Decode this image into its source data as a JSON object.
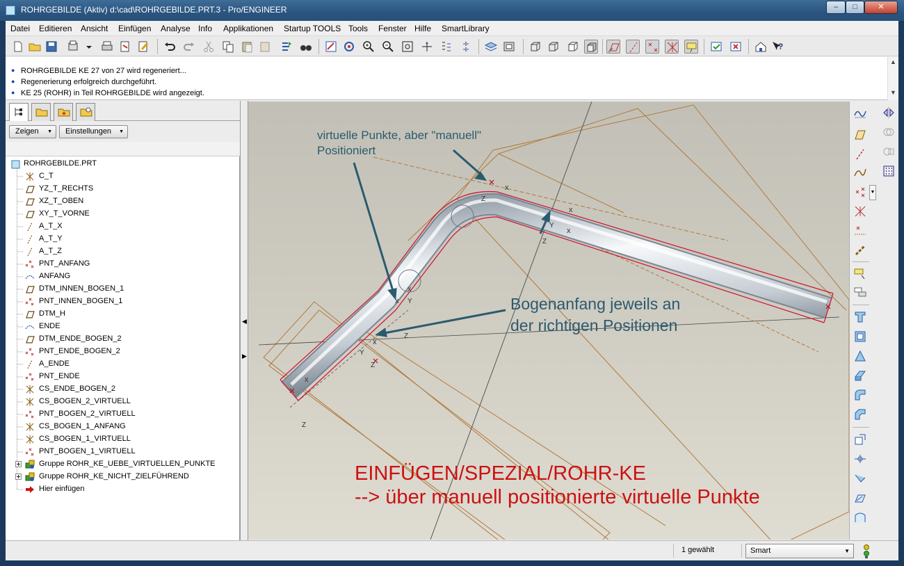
{
  "window": {
    "title": "ROHRGEBILDE (Aktiv) d:\\cad\\ROHRGEBILDE.PRT.3 - Pro/ENGINEER",
    "minimize": "–",
    "maximize": "□",
    "close": "✕"
  },
  "menu": [
    "Datei",
    "Editieren",
    "Ansicht",
    "Einfügen",
    "Analyse",
    "Info",
    "Applikationen",
    "Startup TOOLS",
    "Tools",
    "Fenster",
    "Hilfe",
    "SmartLibrary"
  ],
  "messages": [
    "ROHRGEBILDE KE 27 von 27 wird regeneriert...",
    "Regenerierung erfolgreich durchgeführt.",
    "KE 25 (ROHR) in Teil ROHRGEBILDE wird angezeigt."
  ],
  "model_tree": {
    "show_button": "Zeigen",
    "settings_button": "Einstellungen",
    "root": "ROHRGEBILDE.PRT",
    "items": [
      {
        "label": "C_T",
        "icon": "csys-icon"
      },
      {
        "label": "YZ_T_RECHTS",
        "icon": "datum-plane-icon"
      },
      {
        "label": "XZ_T_OBEN",
        "icon": "datum-plane-icon"
      },
      {
        "label": "XY_T_VORNE",
        "icon": "datum-plane-icon"
      },
      {
        "label": "A_T_X",
        "icon": "datum-axis-icon"
      },
      {
        "label": "A_T_Y",
        "icon": "datum-axis-icon"
      },
      {
        "label": "A_T_Z",
        "icon": "datum-axis-icon"
      },
      {
        "label": "PNT_ANFANG",
        "icon": "datum-point-icon"
      },
      {
        "label": "ANFANG",
        "icon": "curve-icon"
      },
      {
        "label": "DTM_INNEN_BOGEN_1",
        "icon": "datum-plane-icon"
      },
      {
        "label": "PNT_INNEN_BOGEN_1",
        "icon": "datum-point-icon"
      },
      {
        "label": "DTM_H",
        "icon": "datum-plane-icon"
      },
      {
        "label": "ENDE",
        "icon": "curve-icon"
      },
      {
        "label": "DTM_ENDE_BOGEN_2",
        "icon": "datum-plane-icon"
      },
      {
        "label": "PNT_ENDE_BOGEN_2",
        "icon": "datum-point-icon"
      },
      {
        "label": "A_ENDE",
        "icon": "datum-axis-icon"
      },
      {
        "label": "PNT_ENDE",
        "icon": "datum-point-icon"
      },
      {
        "label": "CS_ENDE_BOGEN_2",
        "icon": "csys-icon"
      },
      {
        "label": "CS_BOGEN_2_VIRTUELL",
        "icon": "csys-icon"
      },
      {
        "label": "PNT_BOGEN_2_VIRTUELL",
        "icon": "datum-point-icon"
      },
      {
        "label": "CS_BOGEN_1_ANFANG",
        "icon": "csys-icon"
      },
      {
        "label": "CS_BOGEN_1_VIRTUELL",
        "icon": "csys-icon"
      },
      {
        "label": "PNT_BOGEN_1_VIRTUELL",
        "icon": "datum-point-icon"
      },
      {
        "label": "Gruppe ROHR_KE_UEBE_VIRTUELLEN_PUNKTE",
        "icon": "group-icon"
      },
      {
        "label": "Gruppe ROHR_KE_NICHT_ZIELFÜHREND",
        "icon": "group-icon"
      },
      {
        "label": "Hier einfügen",
        "icon": "insert-arrow-icon"
      }
    ]
  },
  "annotations": {
    "virtual_points": [
      "virtuelle Punkte, aber \"manuell\"",
      "Positioniert"
    ],
    "arc_start": [
      "Bogenanfang jeweils an",
      "der richtigen Positionen"
    ],
    "instruction": [
      "EINFÜGEN/SPEZIAL/ROHR-KE",
      "--> über manuell positionierte virtuelle Punkte"
    ],
    "point_marks": [
      "x",
      "x",
      "x",
      "x",
      "x",
      "x",
      "x"
    ],
    "axis_marks": [
      "Z",
      "Z",
      "Z",
      "Z",
      "Z",
      "Y",
      "Y",
      "Y"
    ]
  },
  "status": {
    "selected": "1 gewählt",
    "filter": "Smart"
  },
  "colors": {
    "annotation_dark": "#2b5a6e",
    "annotation_red": "#cc1111",
    "tube_outline": "#d01030",
    "datum_lines": "#b07a3a",
    "viewport_bg": "#cdcac0"
  }
}
